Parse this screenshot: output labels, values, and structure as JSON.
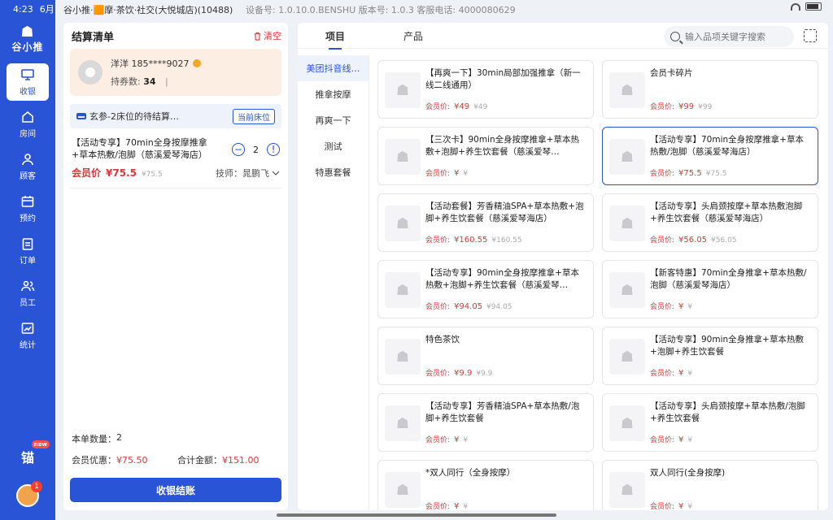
{
  "status": {
    "time": "4:23",
    "date": "6月",
    "store": "谷小推·🟧摩·茶饮·社交(大悦城店)(10488)",
    "device": "设备号: 1.0.10.0.BENSHU  版本号: 1.0.3  客服电话: 4000080629"
  },
  "app": {
    "logo": "谷小推"
  },
  "nav": [
    {
      "label": "收银",
      "icon": "monitor-icon",
      "active": true
    },
    {
      "label": "房间",
      "icon": "house-icon"
    },
    {
      "label": "顾客",
      "icon": "person-icon"
    },
    {
      "label": "预约",
      "icon": "calendar-icon"
    },
    {
      "label": "订单",
      "icon": "clipboard-icon"
    },
    {
      "label": "员工",
      "icon": "staff-icon"
    },
    {
      "label": "统计",
      "icon": "chart-icon"
    }
  ],
  "nav_bottom": {
    "promo": "锚",
    "promo_badge": "new",
    "avatar_badge": "1"
  },
  "checkout": {
    "title": "结算清单",
    "clear": "清空",
    "member": {
      "name": "洋洋 185****9027",
      "coupon_label": "持券数: ",
      "coupon_count": "34",
      "sep": "|"
    },
    "bed": {
      "text": "玄参-2床位的待结算…",
      "button": "当前床位"
    },
    "item": {
      "name": "【活动专享】70min全身按摩推拿+草本热敷/泡脚（慈溪爱琴海店）",
      "qty": "2",
      "price_label": "会员价",
      "price": "¥75.5",
      "orig": "¥75.5",
      "tech": "技师：晁鹏飞"
    },
    "summary": {
      "count_label": "本单数量：",
      "count": "2",
      "discount_label": "会员优惠：",
      "discount": "¥75.50",
      "total_label": "合计金额：",
      "total": "¥151.00"
    },
    "pay": "收银结账"
  },
  "products": {
    "tabs": [
      "项目",
      "产品"
    ],
    "search_placeholder": "输入品项关键字搜索",
    "categories": [
      "美团抖音线…",
      "推拿按摩",
      "再爽一下",
      "测试",
      "特惠套餐"
    ],
    "price_label": "会员价: ",
    "items": [
      {
        "name": "【再爽一下】30min局部加强推拿（新一线二线通用）",
        "price": "¥49",
        "orig": "¥49"
      },
      {
        "name": "会员卡碎片",
        "price": "¥99",
        "orig": "¥99"
      },
      {
        "name": "【三次卡】90min全身按摩推拿+草本热敷+泡脚+养生饮套餐（慈溪爱琴…",
        "price": "¥",
        "orig": "¥"
      },
      {
        "name": "【活动专享】70min全身按摩推拿+草本热敷/泡脚（慈溪爱琴海店）",
        "price": "¥75.5",
        "orig": "¥75.5",
        "selected": true
      },
      {
        "name": "【活动套餐】芳香精油SPA+草本热敷+泡脚+养生饮套餐（慈溪爱琴海店）",
        "price": "¥160.55",
        "orig": "¥160.55"
      },
      {
        "name": "【活动专享】头肩颈按摩+草本热敷泡脚+养生饮套餐（慈溪爱琴海店）",
        "price": "¥56.05",
        "orig": "¥56.05"
      },
      {
        "name": "【活动专享】90min全身按摩推拿+草本热敷+泡脚+养生饮套餐（慈溪爱琴…",
        "price": "¥94.05",
        "orig": "¥94.05"
      },
      {
        "name": "【新客特惠】70min全身推拿+草本热敷/泡脚（慈溪爱琴海店）",
        "price": "¥",
        "orig": "¥"
      },
      {
        "name": "特色茶饮",
        "price": "¥9.9",
        "orig": "¥9.9"
      },
      {
        "name": "【活动专享】90min全身推拿+草本热敷+泡脚+养生饮套餐",
        "price": "¥",
        "orig": "¥"
      },
      {
        "name": "【活动专享】芳香精油SPA+草本热敷/泡脚+养生饮套餐",
        "price": "¥",
        "orig": "¥"
      },
      {
        "name": "【活动专享】头肩颈按摩+草本热敷/泡脚+养生饮套餐",
        "price": "¥",
        "orig": "¥"
      },
      {
        "name": "*双人同行（全身按摩）",
        "price": "¥",
        "orig": "¥"
      },
      {
        "name": "双人同行(全身按摩)",
        "price": "¥",
        "orig": "¥"
      }
    ]
  },
  "colors": {
    "primary": "#2954d6",
    "price": "#e0353a",
    "member_bg": "#fdeee4"
  }
}
